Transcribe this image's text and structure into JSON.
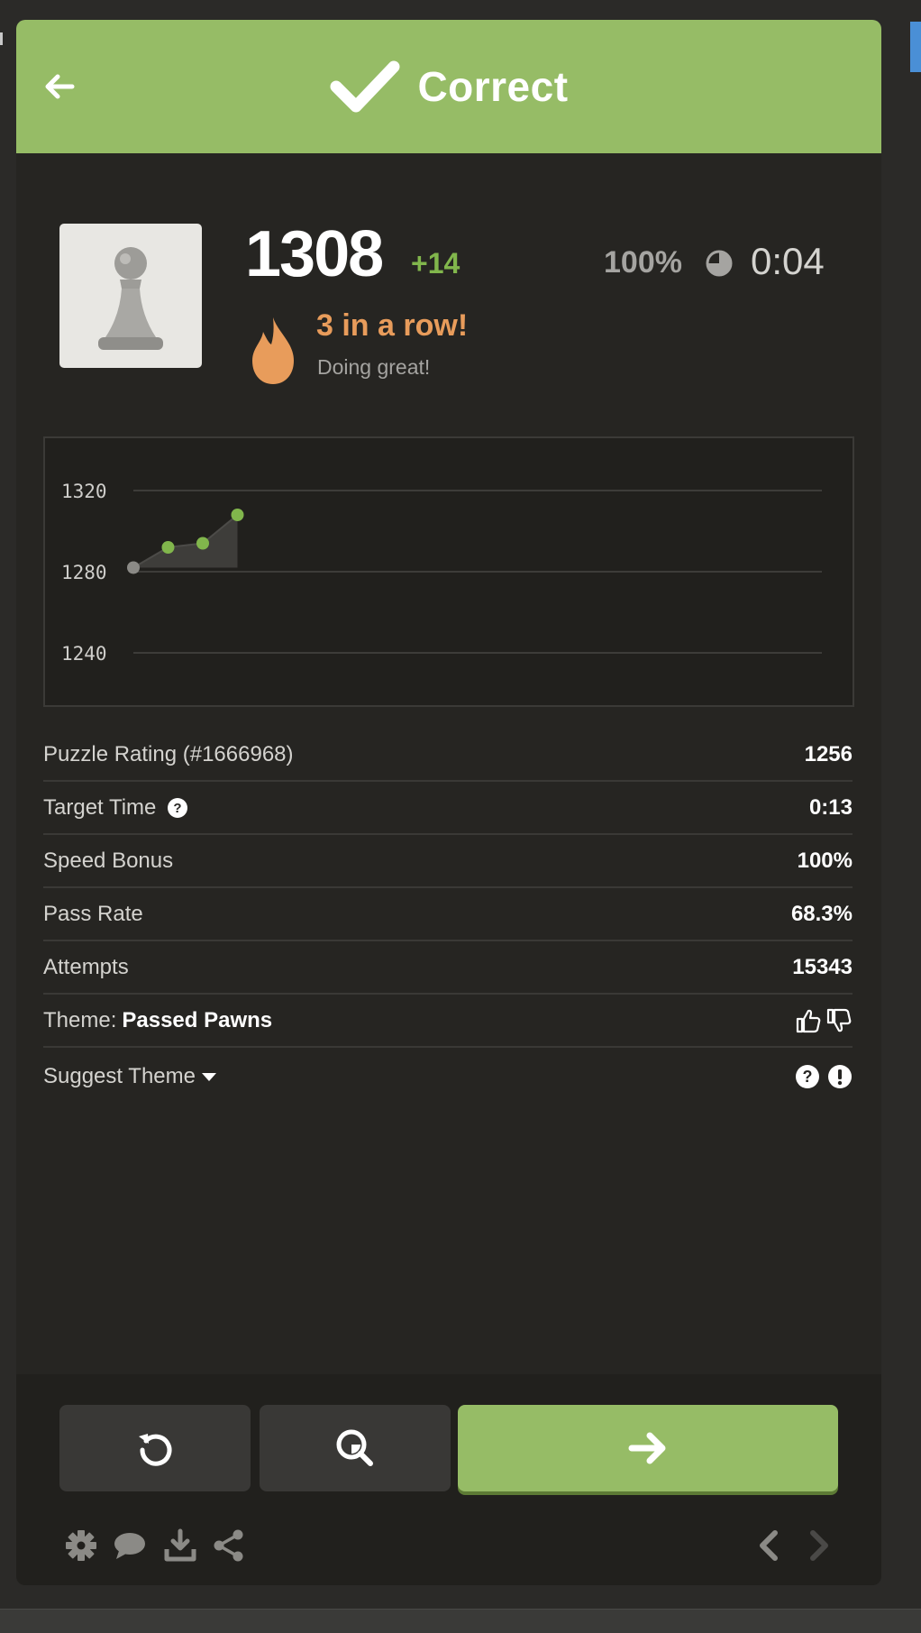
{
  "header": {
    "title": "Correct",
    "color": "#96bc66"
  },
  "player": {
    "avatar_icon": "pawn-icon",
    "rating": "1308",
    "rating_delta": "+14",
    "accuracy": "100%",
    "elapsed_time": "0:04"
  },
  "streak": {
    "title": "3 in a row!",
    "subtitle": "Doing great!"
  },
  "chart_data": {
    "type": "line",
    "x": [
      1,
      2,
      3,
      4
    ],
    "y": [
      1282,
      1292,
      1294,
      1308
    ],
    "yticks": [
      "1320",
      "1280",
      "1240"
    ],
    "ylim": [
      1240,
      1320
    ],
    "grid": true,
    "title": "",
    "xlabel": "",
    "ylabel": ""
  },
  "stats": {
    "rows": [
      {
        "label": "Puzzle Rating (#1666968)",
        "value": "1256"
      },
      {
        "label": "Target Time",
        "value": "0:13"
      },
      {
        "label": "Speed Bonus",
        "value": "100%"
      },
      {
        "label": "Pass Rate",
        "value": "68.3%"
      },
      {
        "label": "Attempts",
        "value": "15343"
      }
    ],
    "theme_label": "Theme:",
    "theme_name": "Passed Pawns",
    "suggest_label": "Suggest Theme"
  },
  "colors": {
    "accent_green": "#81b64c",
    "streak_orange": "#e89c5b",
    "panel_bg": "#262522"
  }
}
